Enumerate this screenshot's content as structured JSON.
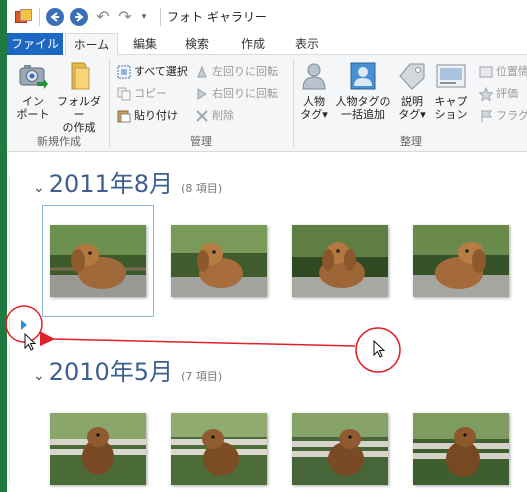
{
  "window": {
    "title": "フォト ギャラリー"
  },
  "ribbon_tabs": [
    {
      "label": "ファイル"
    },
    {
      "label": "ホーム"
    },
    {
      "label": "編集"
    },
    {
      "label": "検索"
    },
    {
      "label": "作成"
    },
    {
      "label": "表示"
    }
  ],
  "ribbon": {
    "new_group": {
      "import_label_1": "イン",
      "import_label_2": "ポート",
      "folder_label_1": "フォルダー",
      "folder_label_2": "の作成",
      "group_label": "新規作成"
    },
    "manage_group": {
      "select_all": "すべて選択",
      "copy": "コピー",
      "paste": "貼り付け",
      "rotate_left": "左回りに回転",
      "rotate_right": "右回りに回転",
      "delete": "削除",
      "group_label": "管理"
    },
    "organize_group": {
      "people_tag_1": "人物",
      "people_tag_2": "タグ▾",
      "batch_people_1": "人物タグの",
      "batch_people_2": "一括追加",
      "desc_tag_1": "説明",
      "desc_tag_2": "タグ▾",
      "caption_1": "キャプ",
      "caption_2": "ション",
      "location": "位置情",
      "rating": "評価",
      "flag": "フラグ",
      "group_label": "整理"
    }
  },
  "gallery": {
    "groups": [
      {
        "title": "2011年8月",
        "count": "(8 項目)"
      },
      {
        "title": "2010年5月",
        "count": "(7 項目)"
      }
    ]
  },
  "icons": {
    "back": "back-arrow-icon",
    "forward": "forward-arrow-icon",
    "undo": "undo-icon",
    "redo": "redo-icon",
    "expand": "expand-triangle-icon",
    "cursor": "mouse-cursor-icon"
  },
  "colors": {
    "file_tab": "#1b67c2",
    "group_title": "#3f5f8f",
    "annotation": "#e0202a",
    "left_bar": "#1e7a3e"
  }
}
